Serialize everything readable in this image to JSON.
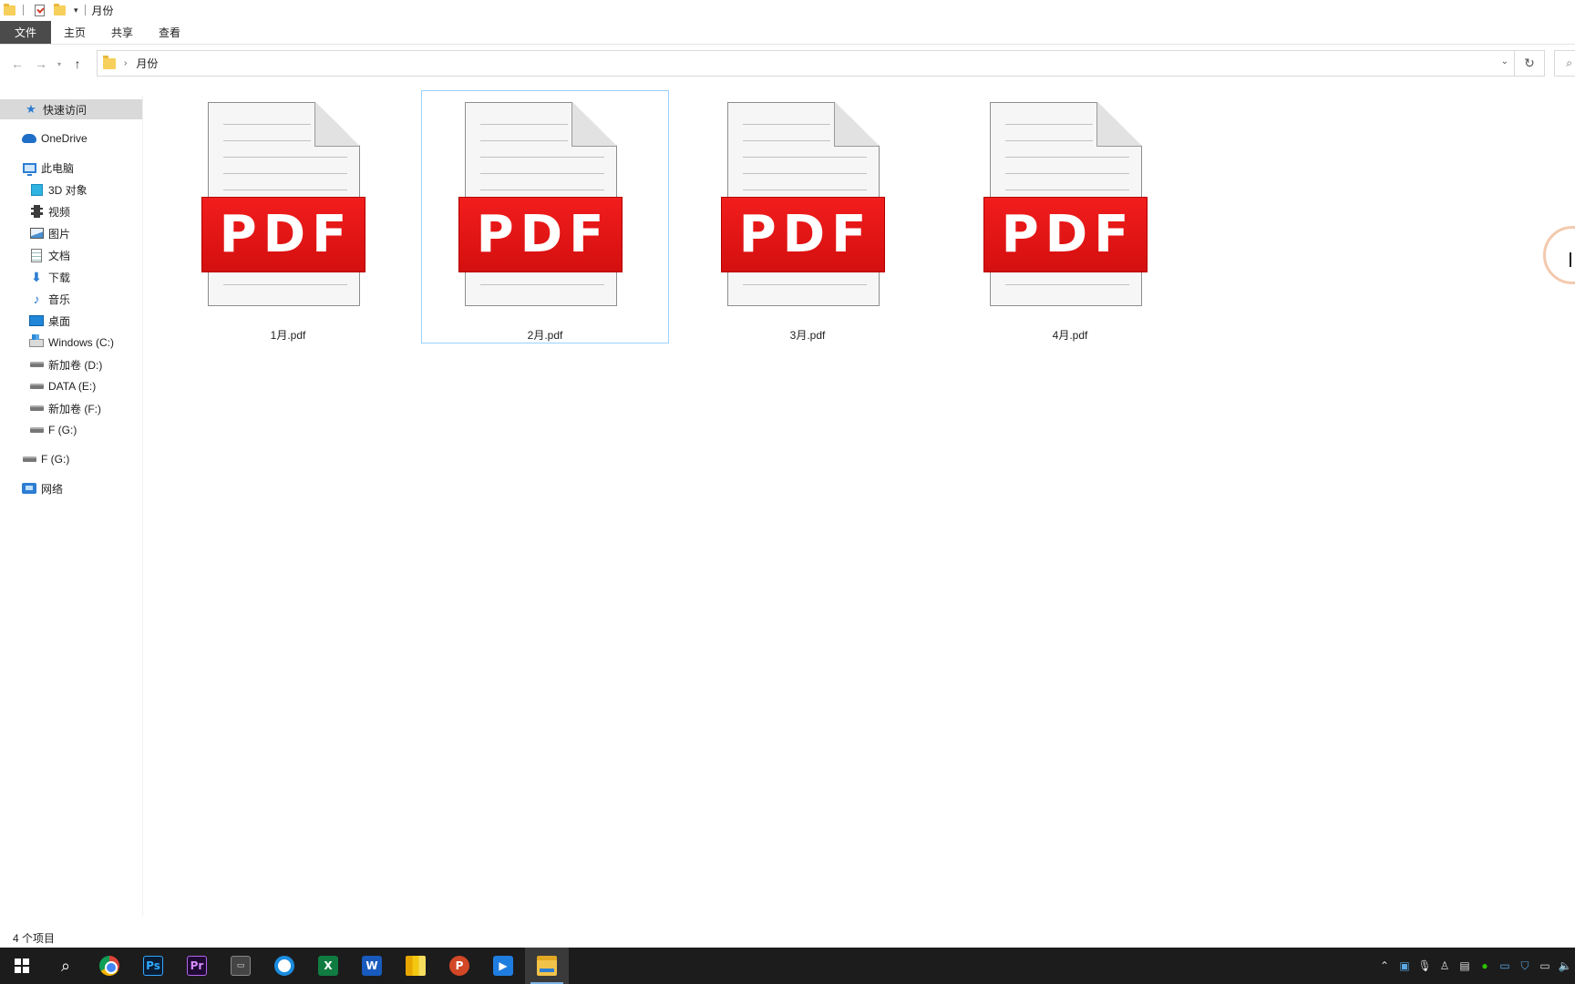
{
  "window": {
    "title": "月份"
  },
  "ribbon": {
    "tabs": [
      "文件",
      "主页",
      "共享",
      "查看"
    ]
  },
  "address": {
    "path": "月份"
  },
  "sidebar": {
    "items": [
      {
        "label": "快速访问",
        "icon": "star-icon"
      },
      {
        "label": "OneDrive",
        "icon": "cloud-icon"
      },
      {
        "label": "此电脑",
        "icon": "computer-icon"
      },
      {
        "label": "3D 对象",
        "icon": "cube-icon"
      },
      {
        "label": "视频",
        "icon": "video-icon"
      },
      {
        "label": "图片",
        "icon": "picture-icon"
      },
      {
        "label": "文档",
        "icon": "document-icon"
      },
      {
        "label": "下载",
        "icon": "download-icon"
      },
      {
        "label": "音乐",
        "icon": "music-icon"
      },
      {
        "label": "桌面",
        "icon": "desktop-icon"
      },
      {
        "label": "Windows (C:)",
        "icon": "system-drive-icon"
      },
      {
        "label": "新加卷 (D:)",
        "icon": "drive-icon"
      },
      {
        "label": "DATA (E:)",
        "icon": "drive-icon"
      },
      {
        "label": "新加卷 (F:)",
        "icon": "drive-icon"
      },
      {
        "label": "F (G:)",
        "icon": "drive-icon"
      },
      {
        "label": "F (G:)",
        "icon": "drive-icon"
      },
      {
        "label": "网络",
        "icon": "network-icon"
      }
    ]
  },
  "files": [
    {
      "name": "1月.pdf",
      "badge": "PDF"
    },
    {
      "name": "2月.pdf",
      "badge": "PDF"
    },
    {
      "name": "3月.pdf",
      "badge": "PDF"
    },
    {
      "name": "4月.pdf",
      "badge": "PDF"
    }
  ],
  "status": {
    "item_count": "4 个项目"
  },
  "taskbar": {
    "apps": [
      "windows-start-icon",
      "search-icon",
      "chrome-icon",
      "photoshop-icon",
      "premiere-icon",
      "terminal-icon",
      "qq-browser-icon",
      "excel-icon",
      "word-icon",
      "power-bi-icon",
      "powerpoint-icon",
      "meeting-icon",
      "file-explorer-icon"
    ],
    "app_labels": {
      "ps": "Ps",
      "pr": "Pr",
      "xl": "X",
      "wd": "W",
      "ppt": "P"
    }
  },
  "colors": {
    "pdf_red": "#e51616",
    "selection_border": "#99d1ff",
    "taskbar_bg": "#1c1c1c"
  }
}
